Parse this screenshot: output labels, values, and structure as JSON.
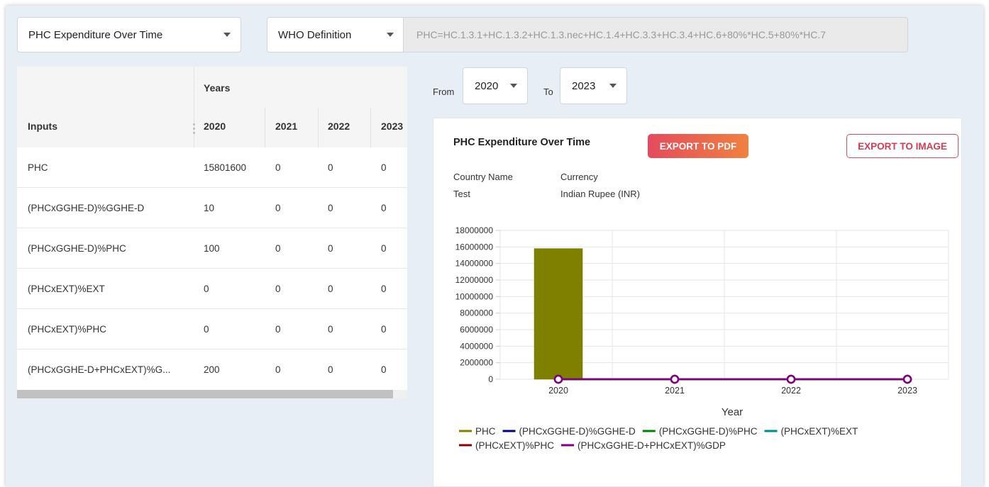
{
  "selectors": {
    "view": "PHC Expenditure Over Time",
    "definition": "WHO Definition",
    "formula": "PHC=HC.1.3.1+HC.1.3.2+HC.1.3.nec+HC.1.4+HC.3.3+HC.3.4+HC.6+80%*HC.5+80%*HC.7"
  },
  "table": {
    "group_header": "Years",
    "inputs_header": "Inputs",
    "year_headers": [
      "2020",
      "2021",
      "2022",
      "2023"
    ],
    "rows": [
      {
        "label": "PHC",
        "values": [
          "15801600",
          "0",
          "0",
          "0"
        ]
      },
      {
        "label": "(PHCxGGHE-D)%GGHE-D",
        "values": [
          "10",
          "0",
          "0",
          "0"
        ]
      },
      {
        "label": "(PHCxGGHE-D)%PHC",
        "values": [
          "100",
          "0",
          "0",
          "0"
        ]
      },
      {
        "label": "(PHCxEXT)%EXT",
        "values": [
          "0",
          "0",
          "0",
          "0"
        ]
      },
      {
        "label": "(PHCxEXT)%PHC",
        "values": [
          "0",
          "0",
          "0",
          "0"
        ]
      },
      {
        "label": "(PHCxGGHE-D+PHCxEXT)%G...",
        "values": [
          "200",
          "0",
          "0",
          "0"
        ]
      }
    ]
  },
  "range": {
    "from_label": "From",
    "from_value": "2020",
    "to_label": "To",
    "to_value": "2023"
  },
  "card": {
    "title": "PHC Expenditure Over Time",
    "export_pdf": "EXPORT TO PDF",
    "export_image": "EXPORT TO IMAGE",
    "country_label": "Country Name",
    "country_value": "Test",
    "currency_label": "Currency",
    "currency_value": "Indian Rupee (INR)"
  },
  "chart_data": {
    "type": "bar",
    "categories": [
      "2020",
      "2021",
      "2022",
      "2023"
    ],
    "xlabel": "Year",
    "ylabel": "",
    "ylim": [
      0,
      18000000
    ],
    "yticks": [
      "0",
      "2000000",
      "4000000",
      "6000000",
      "8000000",
      "10000000",
      "12000000",
      "14000000",
      "16000000",
      "18000000"
    ],
    "grid": true,
    "legend_position": "bottom",
    "series": [
      {
        "name": "PHC",
        "type": "bar",
        "color": "#808000",
        "values": [
          15801600,
          0,
          0,
          0
        ]
      },
      {
        "name": "(PHCxGGHE-D)%GGHE-D",
        "type": "line",
        "color": "#000080",
        "values": [
          10,
          0,
          0,
          0
        ]
      },
      {
        "name": "(PHCxGGHE-D)%PHC",
        "type": "line",
        "color": "#008000",
        "values": [
          100,
          0,
          0,
          0
        ]
      },
      {
        "name": "(PHCxEXT)%EXT",
        "type": "line",
        "color": "#008b8b",
        "values": [
          0,
          0,
          0,
          0
        ]
      },
      {
        "name": "(PHCxEXT)%PHC",
        "type": "line",
        "color": "#8b0000",
        "values": [
          0,
          0,
          0,
          0
        ]
      },
      {
        "name": "(PHCxGGHE-D+PHCxEXT)%GDP",
        "type": "line",
        "color": "#800080",
        "values": [
          200,
          0,
          0,
          0
        ]
      }
    ]
  }
}
